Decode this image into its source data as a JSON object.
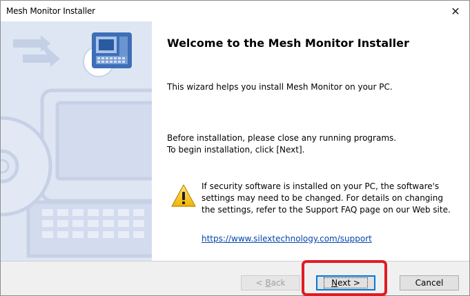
{
  "window": {
    "title": "Mesh Monitor Installer",
    "close_glyph": "✕"
  },
  "content": {
    "heading": "Welcome to the Mesh Monitor Installer",
    "paragraph1": "This wizard helps you install Mesh Monitor on your PC.",
    "paragraph2_line1": "Before installation, please close any running programs.",
    "paragraph2_line2": "To begin installation, click [Next].",
    "warning_text": "If security software is installed on your PC, the software's settings may need to be changed. For details on changing the settings, refer to the Support FAQ page on our Web site.",
    "support_link": "https://www.silextechnology.com/support"
  },
  "buttons": {
    "back_prefix": "< ",
    "back_mnemonic": "B",
    "back_rest": "ack",
    "next_mnemonic": "N",
    "next_rest": "ext >",
    "cancel": "Cancel"
  },
  "colors": {
    "sidebar_bg": "#dfe6f3",
    "link": "#0645ad",
    "highlight": "#e01b24",
    "default_button_border": "#0078d7"
  }
}
